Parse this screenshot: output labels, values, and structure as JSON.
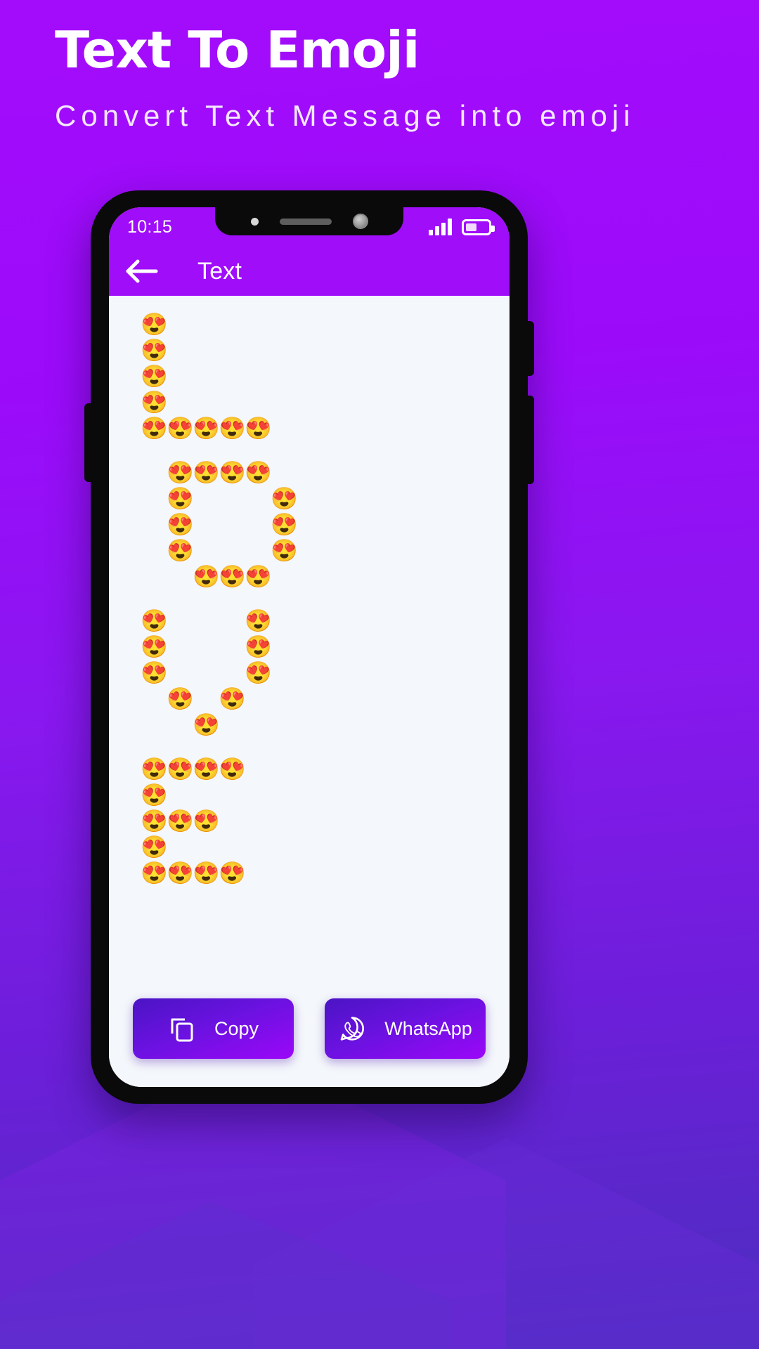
{
  "promo": {
    "title": "Text To Emoji",
    "subtitle": "Convert Text Message into emoji"
  },
  "phone": {
    "status": {
      "time": "10:15",
      "signal_icon": "signal-bars-icon",
      "signal_bars": 4,
      "battery_icon": "battery-icon",
      "battery_level_percent": 42
    },
    "appbar": {
      "back_icon": "back-arrow-icon",
      "title": "Text"
    },
    "content": {
      "emoji_glyph": "😍",
      "letters": [
        {
          "name": "letter-L",
          "grid": [
            [
              1,
              0,
              0,
              0,
              0
            ],
            [
              1,
              0,
              0,
              0,
              0
            ],
            [
              1,
              0,
              0,
              0,
              0
            ],
            [
              1,
              0,
              0,
              0,
              0
            ],
            [
              1,
              2,
              2,
              2,
              2
            ]
          ]
        },
        {
          "name": "letter-O",
          "grid": [
            [
              0,
              1,
              2,
              2,
              2,
              0
            ],
            [
              0,
              1,
              0,
              0,
              0,
              1
            ],
            [
              0,
              1,
              0,
              0,
              0,
              1
            ],
            [
              0,
              1,
              0,
              0,
              0,
              1
            ],
            [
              0,
              0,
              2,
              2,
              2,
              0
            ]
          ]
        },
        {
          "name": "letter-V",
          "grid": [
            [
              1,
              0,
              0,
              0,
              1
            ],
            [
              1,
              0,
              0,
              0,
              1
            ],
            [
              1,
              0,
              0,
              0,
              1
            ],
            [
              0,
              1,
              0,
              1,
              0
            ],
            [
              0,
              0,
              1,
              0,
              0
            ]
          ]
        },
        {
          "name": "letter-E",
          "grid": [
            [
              1,
              2,
              2,
              2
            ],
            [
              1,
              0,
              0,
              0
            ],
            [
              1,
              2,
              2,
              0
            ],
            [
              1,
              0,
              0,
              0
            ],
            [
              1,
              2,
              2,
              2
            ]
          ]
        }
      ]
    },
    "actions": {
      "copy": {
        "label": "Copy",
        "icon": "copy-icon"
      },
      "whatsapp": {
        "label": "WhatsApp",
        "icon": "whatsapp-icon"
      }
    }
  },
  "colors": {
    "brand_purple": "#9f0df9",
    "deep_purple": "#4b14c4",
    "screen_bg": "#f4f7fb",
    "white": "#ffffff"
  }
}
